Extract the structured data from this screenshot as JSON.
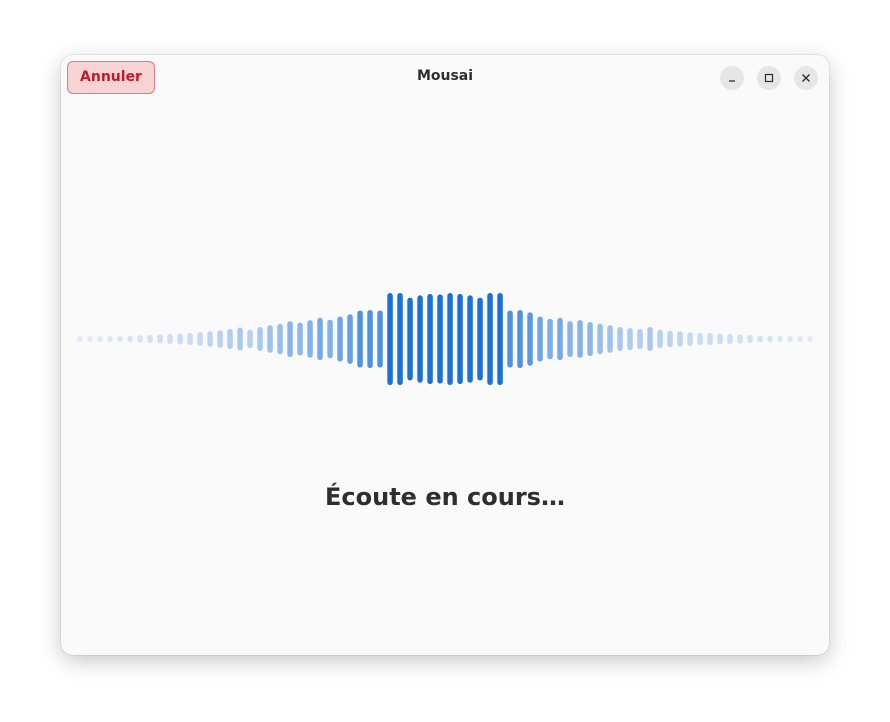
{
  "window": {
    "title": "Mousai"
  },
  "header": {
    "cancel_label": "Annuler",
    "controls": [
      "minimize-icon",
      "maximize-icon",
      "close-icon"
    ]
  },
  "main": {
    "status_text": "Écoute en cours…"
  },
  "colors": {
    "accent": "#1c71d8",
    "destructive": "#c01c28",
    "background": "#fafafa"
  },
  "waveform": {
    "levels": [
      0.02,
      0.03,
      0.04,
      0.05,
      0.06,
      0.07,
      0.08,
      0.09,
      0.1,
      0.11,
      0.12,
      0.13,
      0.15,
      0.17,
      0.19,
      0.22,
      0.25,
      0.2,
      0.26,
      0.3,
      0.33,
      0.39,
      0.36,
      0.41,
      0.46,
      0.42,
      0.49,
      0.54,
      0.62,
      0.63,
      0.62,
      1.0,
      1.0,
      0.9,
      0.95,
      0.98,
      0.97,
      1.0,
      0.98,
      0.95,
      0.9,
      1.0,
      1.0,
      0.62,
      0.63,
      0.58,
      0.49,
      0.44,
      0.46,
      0.39,
      0.41,
      0.37,
      0.33,
      0.3,
      0.26,
      0.24,
      0.22,
      0.26,
      0.2,
      0.18,
      0.17,
      0.15,
      0.13,
      0.13,
      0.12,
      0.11,
      0.1,
      0.09,
      0.08,
      0.07,
      0.06,
      0.05,
      0.04,
      0.03
    ]
  }
}
